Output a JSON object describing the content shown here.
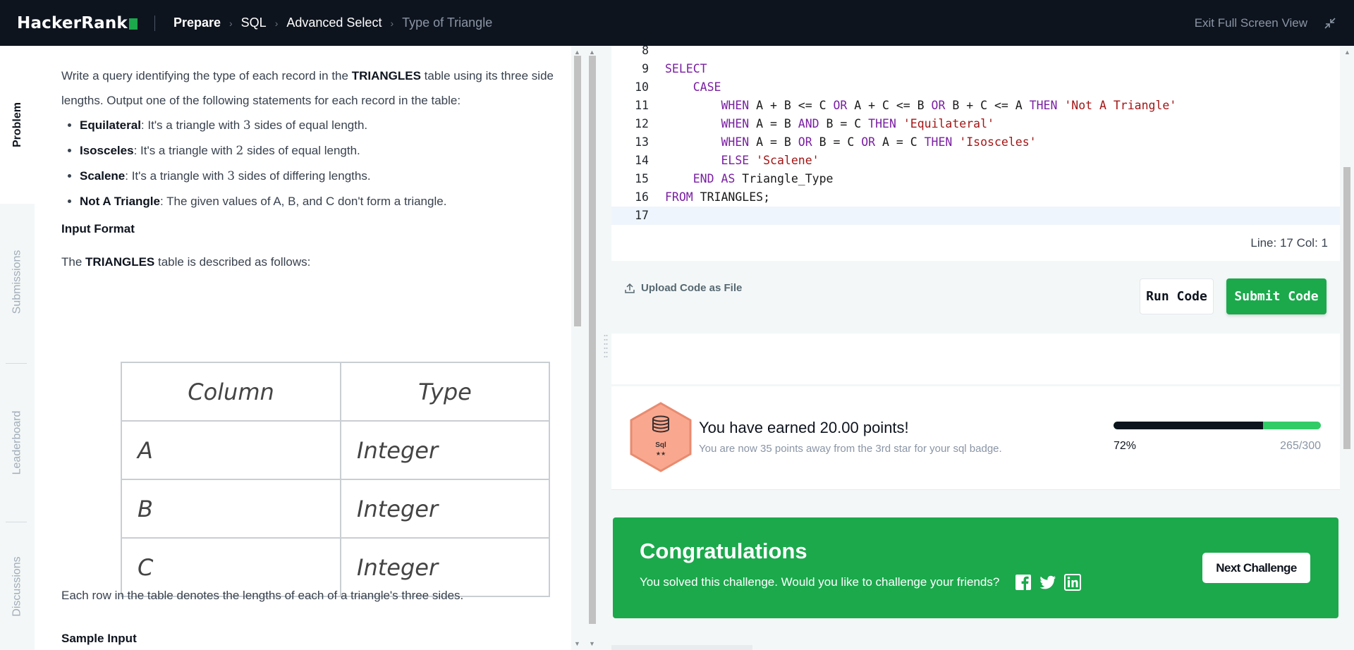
{
  "topbar": {
    "brand": "HackerRank",
    "breadcrumbs": [
      {
        "label": "Prepare"
      },
      {
        "label": "SQL"
      },
      {
        "label": "Advanced Select"
      },
      {
        "label": "Type of Triangle"
      }
    ],
    "exit_label": "Exit Full Screen View"
  },
  "sidetabs": [
    {
      "label": "Problem",
      "active": true
    },
    {
      "label": "Submissions"
    },
    {
      "label": "Leaderboard"
    },
    {
      "label": "Discussions"
    }
  ],
  "problem": {
    "intro_1": "Write a query identifying the type of each record in the ",
    "intro_table": "TRIANGLES",
    "intro_2": " table using its three side lengths. Output one of the following statements for each record in the table:",
    "bullets": [
      {
        "term": "Equilateral",
        "pre": ": It's a triangle with ",
        "num": "3",
        "post": " sides of equal length."
      },
      {
        "term": "Isosceles",
        "pre": ": It's a triangle with ",
        "num": "2",
        "post": " sides of equal length."
      },
      {
        "term": "Scalene",
        "pre": ": It's a triangle with ",
        "num": "3",
        "post": " sides of differing lengths."
      },
      {
        "term": "Not A Triangle",
        "pre": ": The given values of A, B, and C don't form a triangle.",
        "num": "",
        "post": ""
      }
    ],
    "input_format_heading": "Input Format",
    "table_desc_1": "The ",
    "table_desc_name": "TRIANGLES",
    "table_desc_2": " table is described as follows:",
    "table": {
      "headers": [
        "Column",
        "Type"
      ],
      "rows": [
        [
          "A",
          "Integer"
        ],
        [
          "B",
          "Integer"
        ],
        [
          "C",
          "Integer"
        ]
      ]
    },
    "footer_text": "Each row in the table denotes the lengths of each of a triangle's three sides.",
    "sample_heading": "Sample Input"
  },
  "editor": {
    "lines": [
      {
        "n": "8",
        "tokens": []
      },
      {
        "n": "9",
        "tokens": [
          {
            "t": "SELECT",
            "k": "kw"
          }
        ]
      },
      {
        "n": "10",
        "tokens": [
          {
            "t": "    "
          },
          {
            "t": "CASE",
            "k": "kw"
          }
        ]
      },
      {
        "n": "11",
        "tokens": [
          {
            "t": "        "
          },
          {
            "t": "WHEN",
            "k": "kw"
          },
          {
            "t": " A + B <= C "
          },
          {
            "t": "OR",
            "k": "kw"
          },
          {
            "t": " A + C <= B "
          },
          {
            "t": "OR",
            "k": "kw"
          },
          {
            "t": " B + C <= A "
          },
          {
            "t": "THEN",
            "k": "kw"
          },
          {
            "t": " "
          },
          {
            "t": "'Not A Triangle'",
            "k": "str"
          }
        ]
      },
      {
        "n": "12",
        "tokens": [
          {
            "t": "        "
          },
          {
            "t": "WHEN",
            "k": "kw"
          },
          {
            "t": " A = B "
          },
          {
            "t": "AND",
            "k": "kw"
          },
          {
            "t": " B = C "
          },
          {
            "t": "THEN",
            "k": "kw"
          },
          {
            "t": " "
          },
          {
            "t": "'Equilateral'",
            "k": "str"
          }
        ]
      },
      {
        "n": "13",
        "tokens": [
          {
            "t": "        "
          },
          {
            "t": "WHEN",
            "k": "kw"
          },
          {
            "t": " A = B "
          },
          {
            "t": "OR",
            "k": "kw"
          },
          {
            "t": " B = C "
          },
          {
            "t": "OR",
            "k": "kw"
          },
          {
            "t": " A = C "
          },
          {
            "t": "THEN",
            "k": "kw"
          },
          {
            "t": " "
          },
          {
            "t": "'Isosceles'",
            "k": "str"
          }
        ]
      },
      {
        "n": "14",
        "tokens": [
          {
            "t": "        "
          },
          {
            "t": "ELSE",
            "k": "kw"
          },
          {
            "t": " "
          },
          {
            "t": "'Scalene'",
            "k": "str"
          }
        ]
      },
      {
        "n": "15",
        "tokens": [
          {
            "t": "    "
          },
          {
            "t": "END",
            "k": "kw"
          },
          {
            "t": " "
          },
          {
            "t": "AS",
            "k": "kw"
          },
          {
            "t": " Triangle_Type"
          }
        ]
      },
      {
        "n": "16",
        "tokens": [
          {
            "t": "FROM",
            "k": "kw"
          },
          {
            "t": " TRIANGLES;"
          }
        ]
      },
      {
        "n": "17",
        "tokens": [],
        "active": true
      }
    ],
    "line_col": "Line: 17 Col: 1"
  },
  "actions": {
    "upload_label": "Upload Code as File",
    "run_label": "Run Code",
    "submit_label": "Submit Code"
  },
  "result": {
    "badge_label": "Sql",
    "badge_stars": "★★",
    "title": "You have earned 20.00 points!",
    "subtitle": "You are now 35 points away from the 3rd star for your sql badge.",
    "progress_fraction": 0.72,
    "percent_label": "72%",
    "score_label": "265/300"
  },
  "congrats": {
    "title": "Congratulations",
    "subtitle": "You solved this challenge. Would you like to challenge your friends?",
    "next_label": "Next Challenge"
  },
  "colors": {
    "topbar_bg": "#0e141e",
    "brand_green": "#1ba94c",
    "progress_done": "#0e141e",
    "progress_rest": "#32cc67",
    "badge_fill": "#f9a88f",
    "keyword": "#7a1fa2",
    "string": "#a31515"
  }
}
